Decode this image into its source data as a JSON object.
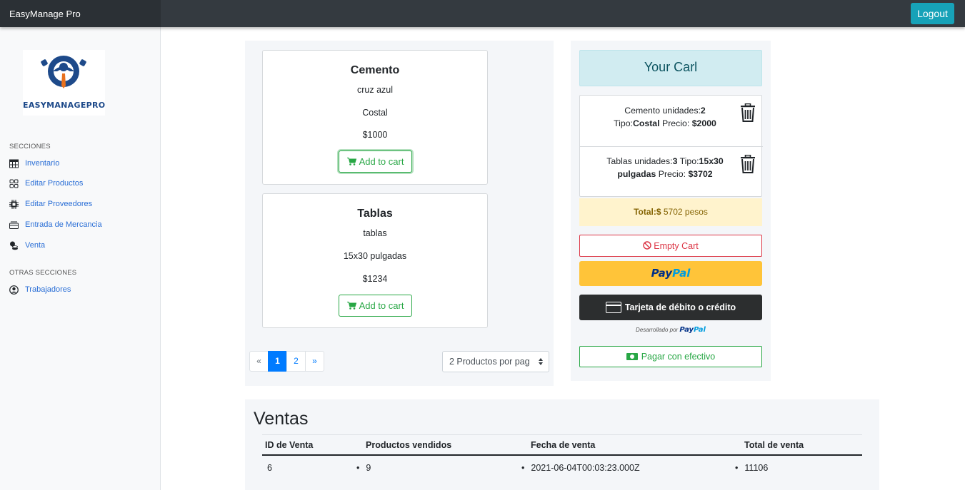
{
  "app": {
    "brand": "EasyManage Pro",
    "logout_label": "Logout"
  },
  "sidebar": {
    "logo_text": "EASYMANAGEPRO",
    "section1": "SECCIONES",
    "items": [
      {
        "label": "Inventario",
        "icon": "table-icon"
      },
      {
        "label": "Editar Productos",
        "icon": "grid-icon"
      },
      {
        "label": "Editar Proveedores",
        "icon": "cpu-icon"
      },
      {
        "label": "Entrada de Mercancia",
        "icon": "inbox-icon"
      },
      {
        "label": "Venta",
        "icon": "coins-icon"
      }
    ],
    "section2": "OTRAS SECCIONES",
    "items2": [
      {
        "label": "Trabajadores",
        "icon": "user-circle-icon"
      }
    ]
  },
  "products": [
    {
      "name": "Cemento",
      "brand": "cruz azul",
      "type": "Costal",
      "price": "$1000",
      "button": "Add to cart"
    },
    {
      "name": "Tablas",
      "brand": "tablas",
      "type": "15x30 pulgadas",
      "price": "$1234",
      "button": "Add to cart"
    }
  ],
  "pagination": {
    "prev": "«",
    "pages": [
      "1",
      "2"
    ],
    "active": "1",
    "next": "»",
    "per_page": "2 Productos por pag"
  },
  "cart": {
    "title": "Your Carl",
    "items": [
      {
        "name": "Cemento",
        "units_label": "unidades:",
        "units": "2",
        "type_label": "Tipo:",
        "type": "Costal",
        "price_label": "Precio:",
        "price": "$2000"
      },
      {
        "name": "Tablas",
        "units_label": "unidades:",
        "units": "3",
        "type_label": "Tipo:",
        "type": "15x30 pulgadas",
        "price_label": "Precio:",
        "price": "$3702"
      }
    ],
    "total_label": "Total:$",
    "total_value": "5702 pesos",
    "empty_label": "Empty Cart",
    "paypal_pay": "Pay",
    "paypal_pal": "Pal",
    "card_label": "Tarjeta de débito o crédito",
    "powered_label": "Desarrollado por",
    "cash_label": "Pagar con efectivo"
  },
  "sales": {
    "title": "Ventas",
    "columns": [
      "ID de Venta",
      "Productos vendidos",
      "Fecha de venta",
      "Total de venta"
    ],
    "rows": [
      [
        "6",
        "9",
        "2021-06-04T00:03:23.000Z",
        "11106"
      ]
    ]
  },
  "colors": {
    "primary": "#007bff",
    "success": "#28a745",
    "danger": "#dc3545",
    "info": "#17a2b8",
    "dark": "#343a40",
    "paypal_yellow": "#ffc439"
  }
}
